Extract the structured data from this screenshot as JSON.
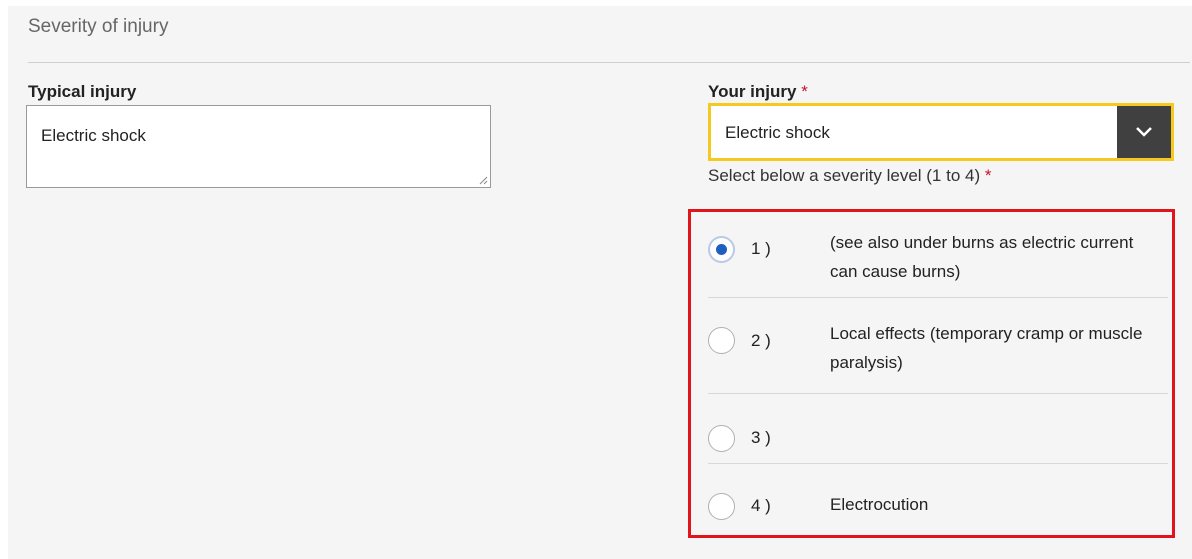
{
  "section": {
    "title": "Severity of injury"
  },
  "typical_injury": {
    "label": "Typical injury",
    "value": "Electric shock"
  },
  "your_injury": {
    "label": "Your injury",
    "required_marker": "*",
    "selected": "Electric shock",
    "dropdown_icon": "chevron-down-icon"
  },
  "severity": {
    "hint": "Select below a severity level (1 to 4)",
    "required_marker": "*",
    "selected_level": 1,
    "options": [
      {
        "number": "1 )",
        "description": "(see also under burns as electric current can cause burns)",
        "checked": true
      },
      {
        "number": "2 )",
        "description": "Local effects (temporary cramp or muscle paralysis)",
        "checked": false
      },
      {
        "number": "3 )",
        "description": "",
        "checked": false
      },
      {
        "number": "4 )",
        "description": "Electrocution",
        "checked": false
      }
    ]
  },
  "colors": {
    "panel_bg": "#f5f5f5",
    "focus_outline": "#f4c920",
    "required": "#c8102e",
    "radio_selected": "#1f5fbf",
    "highlight_annotation": "#e0151b",
    "dropdown_button": "#404040"
  }
}
